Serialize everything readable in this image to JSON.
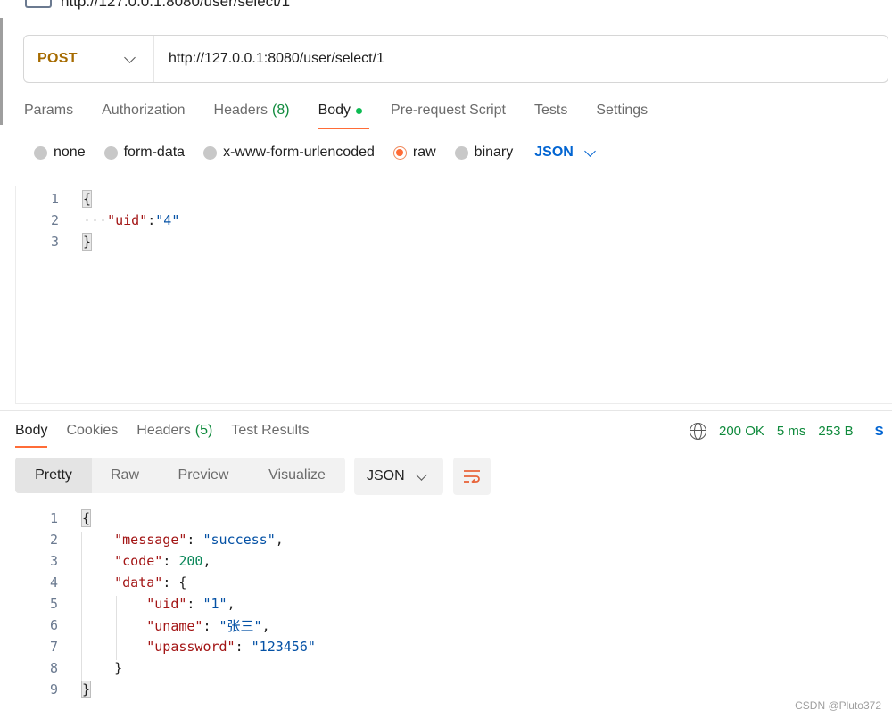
{
  "request": {
    "title": "http://127.0.0.1:8080/user/select/1",
    "method": "POST",
    "url": "http://127.0.0.1:8080/user/select/1"
  },
  "request_tabs": [
    {
      "label": "Params"
    },
    {
      "label": "Authorization"
    },
    {
      "label": "Headers",
      "count": "(8)"
    },
    {
      "label": "Body",
      "active": true
    },
    {
      "label": "Pre-request Script"
    },
    {
      "label": "Tests"
    },
    {
      "label": "Settings"
    }
  ],
  "body_types": [
    {
      "label": "none"
    },
    {
      "label": "form-data"
    },
    {
      "label": "x-www-form-urlencoded"
    },
    {
      "label": "raw",
      "checked": true
    },
    {
      "label": "binary"
    }
  ],
  "body_language": "JSON",
  "request_body": {
    "line1": "{",
    "line2_key": "\"uid\"",
    "line2_value": "\"4\"",
    "line3": "}"
  },
  "line_numbers": [
    "1",
    "2",
    "3",
    "4",
    "5",
    "6",
    "7",
    "8",
    "9"
  ],
  "response_tabs": [
    {
      "label": "Body",
      "active": true
    },
    {
      "label": "Cookies"
    },
    {
      "label": "Headers",
      "count": "(5)"
    },
    {
      "label": "Test Results"
    }
  ],
  "response_status": {
    "status": "200 OK",
    "time": "5 ms",
    "size": "253 B",
    "save_fragment": "S"
  },
  "response_views": [
    "Pretty",
    "Raw",
    "Preview",
    "Visualize"
  ],
  "response_format": "JSON",
  "response_body": {
    "message_key": "\"message\"",
    "message_value": "\"success\"",
    "code_key": "\"code\"",
    "code_value": "200",
    "data_key": "\"data\"",
    "uid_key": "\"uid\"",
    "uid_value": "\"1\"",
    "uname_key": "\"uname\"",
    "uname_value": "\"张三\"",
    "upassword_key": "\"upassword\"",
    "upassword_value": "\"123456\""
  },
  "colors": {
    "accent": "#ff6c37",
    "method": "#a66b00",
    "success": "#0f8a3c",
    "link": "#0265d2"
  },
  "watermark": "CSDN @Pluto372"
}
